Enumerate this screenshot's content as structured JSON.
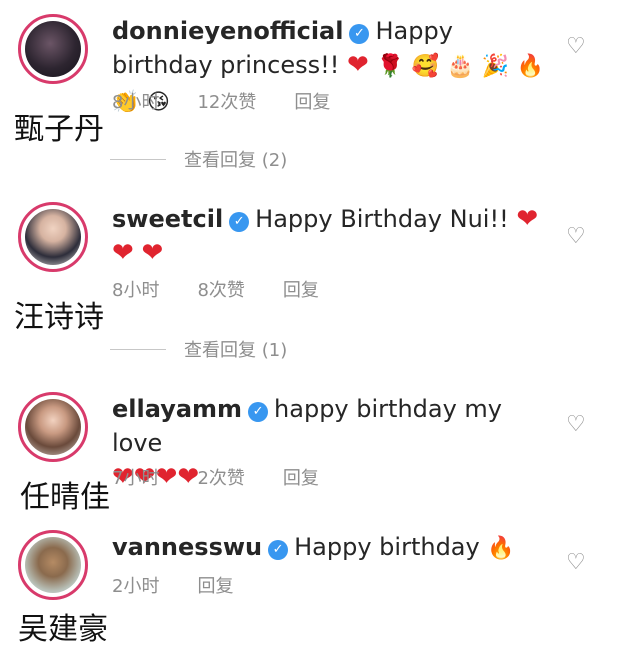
{
  "comments": [
    {
      "username": "donnieyenofficial",
      "text": "Happy birthday princess!!",
      "emojis": [
        "❤",
        "🌹",
        "🥰",
        "🎂",
        "🎉",
        "🔥",
        "👏",
        "😘"
      ],
      "time": "8小时",
      "likes": "12次赞",
      "reply": "回复",
      "view_replies": "查看回复 (2)",
      "overlay_name": "甄子丹"
    },
    {
      "username": "sweetcil",
      "text": "Happy Birthday Nui!!",
      "emojis": [
        "❤",
        "❤",
        "❤"
      ],
      "time": "8小时",
      "likes": "8次赞",
      "reply": "回复",
      "view_replies": "查看回复 (1)",
      "overlay_name": "汪诗诗"
    },
    {
      "username": "ellayamm",
      "text": "happy birthday my love",
      "emojis": [
        "❤",
        "❤",
        "❤",
        "❤"
      ],
      "time": "7小时",
      "likes": "2次赞",
      "reply": "回复",
      "overlay_name": "任晴佳"
    },
    {
      "username": "vannesswu",
      "text": "Happy birthday",
      "emojis": [
        "🔥"
      ],
      "time": "2小时",
      "reply": "回复",
      "overlay_name": "吴建豪"
    }
  ],
  "icons": {
    "like": "heart-outline-icon",
    "verified": "verified-badge-icon"
  },
  "colors": {
    "verified": "#3897f0",
    "avatar_ring": "#d83a6b",
    "meta": "#8e8e8e"
  }
}
